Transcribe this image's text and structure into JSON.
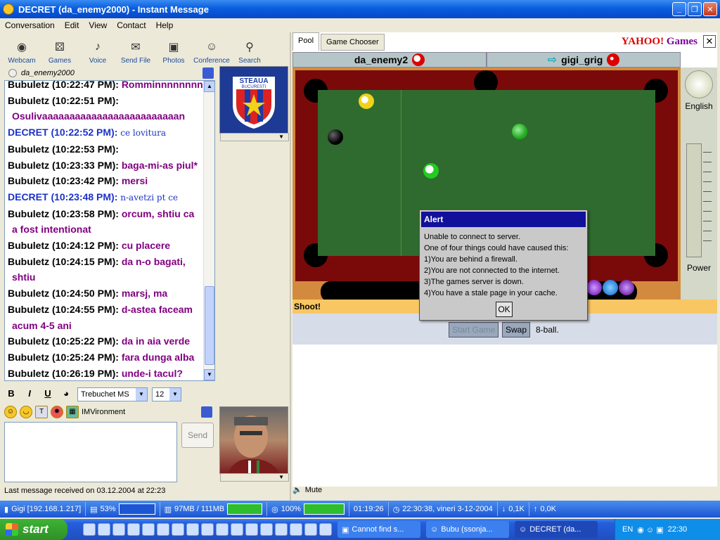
{
  "window": {
    "title": "DECRET  (da_enemy2000) - Instant Message"
  },
  "menu": [
    "Conversation",
    "Edit",
    "View",
    "Contact",
    "Help"
  ],
  "toolbar": [
    {
      "label": "Webcam",
      "icon": "webcam-icon"
    },
    {
      "label": "Games",
      "icon": "dice-icon"
    },
    {
      "label": "Voice",
      "icon": "voice-icon"
    },
    {
      "label": "Send File",
      "icon": "send-file-icon"
    },
    {
      "label": "Photos",
      "icon": "photos-icon"
    },
    {
      "label": "Conference",
      "icon": "conference-icon"
    },
    {
      "label": "Search",
      "icon": "search-icon"
    }
  ],
  "chat": {
    "to": "da_enemy2000",
    "lines": [
      {
        "name": "Bubuletz (10:22:47 PM):",
        "msg": "Romminnnnnnnn",
        "me": false
      },
      {
        "name": "Bubuletz (10:22:51 PM):",
        "msg": "",
        "me": false
      },
      {
        "name": "",
        "msg": "Osulivaaaaaaaaaaaaaaaaaaaaaaaaan",
        "me": false
      },
      {
        "name": "DECRET (10:22:52 PM):",
        "msg": "ce lovitura",
        "me": true
      },
      {
        "name": "Bubuletz (10:22:53 PM):",
        "msg": "",
        "me": false
      },
      {
        "name": "Bubuletz (10:23:33 PM):",
        "msg": "baga-mi-as piul*",
        "me": false
      },
      {
        "name": "Bubuletz (10:23:42 PM):",
        "msg": "mersi",
        "me": false
      },
      {
        "name": "DECRET (10:23:48 PM):",
        "msg": "n-avetzi pt ce",
        "me": true
      },
      {
        "name": "Bubuletz (10:23:58 PM):",
        "msg": "orcum, shtiu ca",
        "me": false
      },
      {
        "name": "",
        "msg": "a fost intentionat",
        "me": false
      },
      {
        "name": "Bubuletz (10:24:12 PM):",
        "msg": "cu placere",
        "me": false
      },
      {
        "name": "Bubuletz (10:24:15 PM):",
        "msg": "da n-o bagati,",
        "me": false
      },
      {
        "name": "",
        "msg": "shtiu",
        "me": false
      },
      {
        "name": "Bubuletz (10:24:50 PM):",
        "msg": "marsj, ma",
        "me": false
      },
      {
        "name": "Bubuletz (10:24:55 PM):",
        "msg": "d-astea faceam",
        "me": false
      },
      {
        "name": "",
        "msg": "acum 4-5 ani",
        "me": false
      },
      {
        "name": "Bubuletz (10:25:22 PM):",
        "msg": "da in aia verde",
        "me": false
      },
      {
        "name": "Bubuletz (10:25:24 PM):",
        "msg": "fara dunga alba",
        "me": false
      },
      {
        "name": "Bubuletz (10:26:19 PM):",
        "msg": "unde-i tacul?",
        "me": false
      }
    ]
  },
  "format": {
    "font": "Trebuchet MS",
    "size": "12",
    "imv": "IMVironment"
  },
  "send_label": "Send",
  "status_text": "Last message received on 03.12.2004 at 22:23",
  "game": {
    "tabs": [
      "Pool",
      "Game Chooser"
    ],
    "logo_a": "YAHOO!",
    "logo_b": "Games",
    "player1": "da_enemy2",
    "player2": "gigi_grig",
    "lang": "English",
    "power": "Power",
    "shoot": "Shoot!",
    "start_game": "Start Game",
    "swap": "Swap",
    "mode": "8-ball."
  },
  "alert": {
    "title": "Alert",
    "lines": [
      "Unable to connect to server.",
      "One of four things could have caused this:",
      "1)You are behind a firewall.",
      "2)You are not connected to the internet.",
      "3)The games server is down.",
      "4)You have a stale page in your cache."
    ],
    "ok": "OK"
  },
  "mute": "Mute",
  "sysbar": {
    "host": "Gigi [192.168.1.217]",
    "cpu": "53%",
    "mem": "97MB / 111MB",
    "disk": "100%",
    "uptime": "01:19:26",
    "datetime": "22:30:38, vineri 3-12-2004",
    "down": "0,1K",
    "up": "0,0K"
  },
  "taskbar": {
    "start": "start",
    "tasks": [
      "Cannot find s...",
      "Bubu  (ssonja...",
      "DECRET  (da..."
    ],
    "lang": "EN",
    "clock": "22:30"
  }
}
